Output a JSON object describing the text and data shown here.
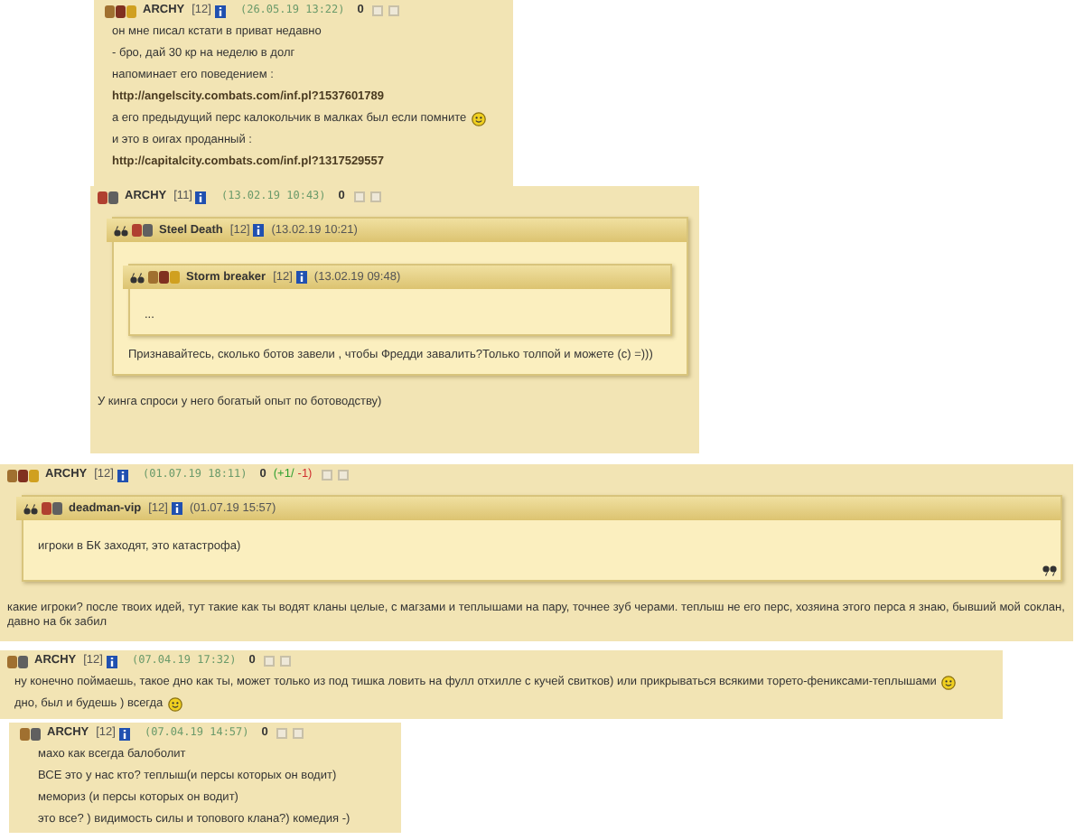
{
  "posts": [
    {
      "author": "ARCHY",
      "level": "[12]",
      "date": "(26.05.19 13:22)",
      "score": "0",
      "paragraphs": [
        {
          "kind": "text",
          "text": "он мне писал кстати в приват недавно",
          "smiley": false
        },
        {
          "kind": "text",
          "text": "- бро, дай 30 кр на неделю в долг",
          "smiley": false
        },
        {
          "kind": "text",
          "text": "напоминает его поведением :",
          "smiley": false
        },
        {
          "kind": "link",
          "text": "http://angelscity.combats.com/inf.pl?1537601789",
          "smiley": false
        },
        {
          "kind": "text",
          "text": "а его предыдущий перс калокольчик в малках был если помните",
          "smiley": true
        },
        {
          "kind": "text",
          "text": "и это в оигах проданный :",
          "smiley": false
        },
        {
          "kind": "link",
          "text": "http://capitalcity.combats.com/inf.pl?1317529557",
          "smiley": false
        }
      ]
    },
    {
      "author": "ARCHY",
      "level": "[11]",
      "date": "(13.02.19 10:43)",
      "score": "0",
      "quote": {
        "author": "Steel Death",
        "level": "[12]",
        "date": "(13.02.19 10:21)",
        "closed": false,
        "quote": {
          "author": "Storm breaker",
          "level": "[12]",
          "date": "(13.02.19 09:48)",
          "closed": false,
          "body": "..."
        },
        "body": "Признавайтесь, сколько ботов завели , чтобы Фредди завалить?Только толпой и можете (с) =)))"
      },
      "paragraphs": [
        {
          "kind": "text",
          "text": "У кинга спроси у него богатый опыт по ботоводству)",
          "smiley": false
        }
      ]
    },
    {
      "author": "ARCHY",
      "level": "[12]",
      "date": "(01.07.19 18:11)",
      "score": "0",
      "plus": "(+1/",
      "minus": "-1)",
      "quote": {
        "author": "deadman-vip",
        "level": "[12]",
        "date": "(01.07.19 15:57)",
        "closed": true,
        "body": "игроки в БК заходят, это катастрофа)"
      },
      "paragraphs": [
        {
          "kind": "text",
          "text": "какие игроки? после твоих идей, тут такие как ты водят кланы целые, с магзами и теплышами на пару, точнее зуб черами. теплыш не его перс, хозяина этого перса я знаю, бывший мой соклан, давно на бк забил",
          "smiley": false
        }
      ]
    },
    {
      "author": "ARCHY",
      "level": "[12]",
      "date": "(07.04.19 17:32)",
      "score": "0",
      "paragraphs": [
        {
          "kind": "text",
          "text": "ну конечно поймаешь, такое дно как ты, может только из под тишка ловить на фулл отхилле с кучей свитков) или прикрываться всякими торето-фениксами-теплышами",
          "smiley": true
        },
        {
          "kind": "text",
          "text": "дно, был и будешь ) всегда",
          "smiley": true
        }
      ]
    },
    {
      "author": "ARCHY",
      "level": "[12]",
      "date": "(07.04.19 14:57)",
      "score": "0",
      "paragraphs": [
        {
          "kind": "text",
          "text": "махо как всегда балоболит",
          "smiley": false
        },
        {
          "kind": "text",
          "text": "ВСЕ это у нас кто? теплыш(и персы которых он водит)",
          "smiley": false
        },
        {
          "kind": "text",
          "text": "мемориз (и персы которых он водит)",
          "smiley": false
        },
        {
          "kind": "text",
          "text": "это все? ) видимость силы и топового клана?) комедия -)",
          "smiley": false
        }
      ]
    }
  ]
}
